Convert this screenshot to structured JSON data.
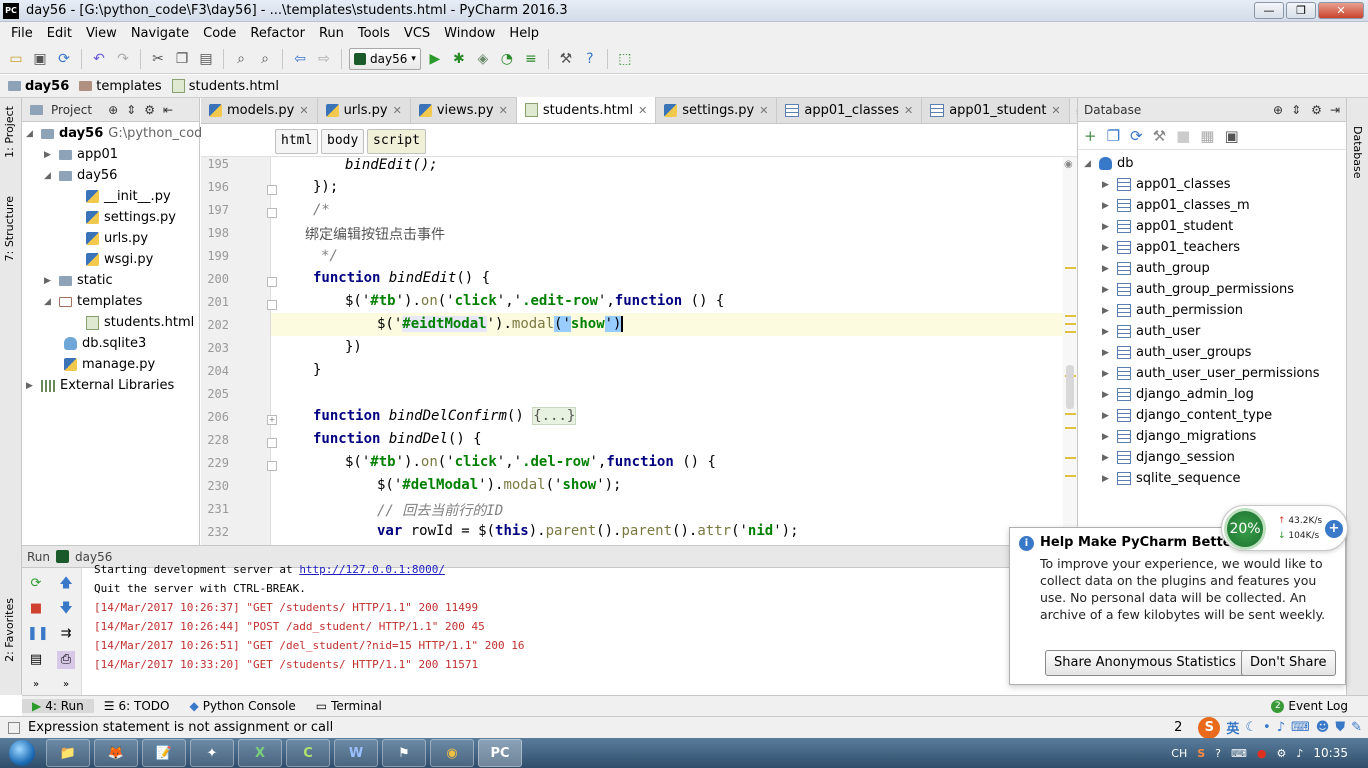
{
  "window": {
    "title": "day56 - [G:\\python_code\\F3\\day56] - ...\\templates\\students.html - PyCharm 2016.3",
    "logo": "PC",
    "controls": [
      "—",
      "❐",
      "✕"
    ]
  },
  "menu": [
    "File",
    "Edit",
    "View",
    "Navigate",
    "Code",
    "Refactor",
    "Run",
    "Tools",
    "VCS",
    "Window",
    "Help"
  ],
  "toolbar": {
    "run_config": "day56"
  },
  "breadcrumb": [
    "day56",
    "templates",
    "students.html"
  ],
  "left_tool_tabs": [
    "1: Project",
    "7: Structure",
    "2: Favorites"
  ],
  "project": {
    "header": "Project",
    "root_name": "day56",
    "root_path": "G:\\python_code",
    "items": [
      "app01",
      "day56",
      "__init__.py",
      "settings.py",
      "urls.py",
      "wsgi.py",
      "static",
      "templates",
      "students.html",
      "db.sqlite3",
      "manage.py",
      "External Libraries"
    ]
  },
  "tabs": [
    "models.py",
    "urls.py",
    "views.py",
    "students.html",
    "settings.py",
    "app01_classes",
    "app01_student"
  ],
  "tabs_overflow": "≡1",
  "tag_path": [
    "html",
    "body",
    "script"
  ],
  "line_numbers": [
    "195",
    "196",
    "197",
    "198",
    "199",
    "200",
    "201",
    "202",
    "203",
    "204",
    "205",
    "206",
    "228",
    "229",
    "230",
    "231",
    "232"
  ],
  "code": {
    "l195": "bindEdit();",
    "l196": "});",
    "l197": "/*",
    "l198": "绑定编辑按钮点击事件",
    "l199": "*/",
    "kw_function": "function",
    "fn_bindEdit": "bindEdit",
    "l200_tail": "() {",
    "l201_a": "$('",
    "l201_tb": "#tb",
    "l201_b": "').",
    "l201_on": "on",
    "l201_c": "('",
    "l201_click": "click",
    "l201_d": "','",
    "l201_sel": ".edit-row",
    "l201_e": "',",
    "l201_f": " () {",
    "l202_a": "$('",
    "l202_id": "#eidtModal",
    "l202_b": "').",
    "l202_modal": "modal",
    "l202_c": "('",
    "l202_show": "show",
    "l202_d": "')",
    "l203": "})",
    "l204": "}",
    "fn_bindDelConfirm": "bindDelConfirm",
    "l206_tail": "() ",
    "l206_fold": "{...}",
    "fn_bindDel": "bindDel",
    "l228_tail": "() {",
    "l229_sel": ".del-row",
    "l230_id": "#delModal",
    "l230_d": "');",
    "l231": "// 回去当前行的ID",
    "l232_var": "var",
    "l232_a": " rowId = $(",
    "l232_this": "this",
    "l232_b": ").",
    "l232_parent": "parent",
    "l232_c": "().",
    "l232_attr": "attr",
    "l232_d": "('",
    "l232_nid": "nid",
    "l232_e": "');"
  },
  "database": {
    "header": "Database",
    "root": "db",
    "tables": [
      "app01_classes",
      "app01_classes_m",
      "app01_student",
      "app01_teachers",
      "auth_group",
      "auth_group_permissions",
      "auth_permission",
      "auth_user",
      "auth_user_groups",
      "auth_user_user_permissions",
      "django_admin_log",
      "django_content_type",
      "django_migrations",
      "django_session",
      "sqlite_sequence"
    ]
  },
  "right_tool_tab": "Database",
  "run": {
    "label": "Run",
    "config": "day56",
    "lines": [
      {
        "text": "Starting development server at ",
        "link": "http://127.0.0.1:8000/"
      },
      {
        "text": "Quit the server with CTRL-BREAK."
      },
      {
        "text": "[14/Mar/2017 10:26:37] \"GET /students/ HTTP/1.1\" 200 11499"
      },
      {
        "text": "[14/Mar/2017 10:26:44] \"POST /add_student/ HTTP/1.1\" 200 45"
      },
      {
        "text": "[14/Mar/2017 10:26:51] \"GET /del_student/?nid=15 HTTP/1.1\" 200 16"
      },
      {
        "text": "[14/Mar/2017 10:33:20] \"GET /students/ HTTP/1.1\" 200 11571"
      }
    ]
  },
  "bottom_tabs": [
    "4: Run",
    "6: TODO",
    "Python Console",
    "Terminal"
  ],
  "event_log": {
    "count": "2",
    "label": "Event Log"
  },
  "status_message": "Expression statement is not assignment or call",
  "status_right": "2",
  "popup": {
    "title": "Help Make PyCharm Better",
    "body": "To improve your experience, we would like to collect data on the plugins and features you use. No personal data will be collected. An archive of a few kilobytes will be sent weekly.",
    "btn_share": "Share Anonymous Statistics",
    "btn_decline": "Don't Share"
  },
  "net_widget": {
    "percent": "20%",
    "up": "43.2K/s",
    "down": "104K/s"
  },
  "taskbar": {
    "apps": [
      "📁",
      "🦊",
      "📝",
      "✦",
      "X",
      "C",
      "W",
      "⚑",
      "◉",
      "PC"
    ],
    "tray": [
      "CH",
      "S",
      "?",
      "⌨",
      "●",
      "⚙",
      "♪"
    ],
    "clock": "10:35",
    "ime": "英"
  }
}
